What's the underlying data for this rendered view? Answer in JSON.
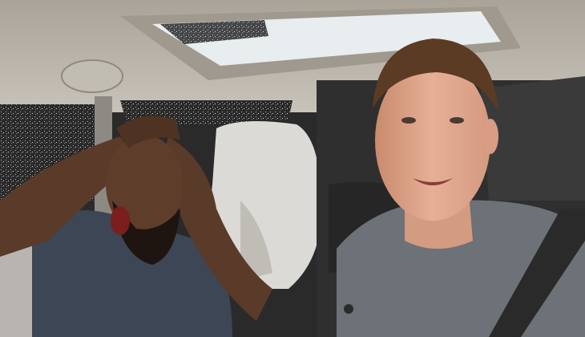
{
  "colors": {
    "headliner": "#b9b4aa",
    "headliner_shadow": "#8e887e",
    "sunroof_glass": "#e9eef0",
    "window_noise": "#1c1c1c",
    "seat": "#dcdad6",
    "seat_shadow": "#b3b0aa",
    "dark_interior": "#2e2e2e",
    "skin_dark": "#5a3a28",
    "skin_light": "#e2a98c",
    "shirt_dark": "#3c4654",
    "shirt_grey": "#6d7178",
    "hair": "#5b3b24",
    "belt": "#2a2a2a"
  },
  "icons": {
    "scene": "car-selfie-photo"
  }
}
